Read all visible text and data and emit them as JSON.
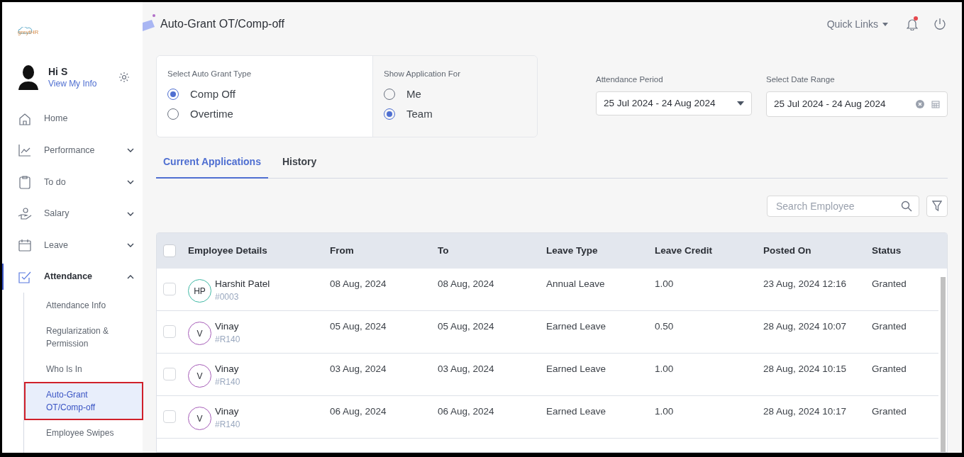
{
  "sidebar": {
    "logo_text": "greytHR",
    "greeting": "Hi S",
    "profile_link": "View My Info",
    "items": [
      {
        "label": "Home",
        "kind": "link",
        "active": false
      },
      {
        "label": "Performance",
        "kind": "group",
        "expanded": false,
        "active": false
      },
      {
        "label": "To do",
        "kind": "group",
        "expanded": false,
        "active": false
      },
      {
        "label": "Salary",
        "kind": "group",
        "expanded": false,
        "active": false
      },
      {
        "label": "Leave",
        "kind": "group",
        "expanded": false,
        "active": false
      },
      {
        "label": "Attendance",
        "kind": "group",
        "expanded": true,
        "active": true,
        "children": [
          {
            "label": "Attendance Info",
            "selected": false
          },
          {
            "label": "Regularization & Permission",
            "selected": false
          },
          {
            "label": "Who Is In",
            "selected": false
          },
          {
            "label": "Auto-Grant OT/Comp-off",
            "selected": true
          },
          {
            "label": "Employee Swipes",
            "selected": false
          }
        ]
      }
    ]
  },
  "header": {
    "title": "Auto-Grant OT/Comp-off",
    "quick_links": "Quick Links",
    "has_notification": true
  },
  "grant_type": {
    "label": "Select Auto Grant Type",
    "options": [
      {
        "label": "Comp Off",
        "selected": true
      },
      {
        "label": "Overtime",
        "selected": false
      }
    ]
  },
  "application_for": {
    "label": "Show Application For",
    "options": [
      {
        "label": "Me",
        "selected": false
      },
      {
        "label": "Team",
        "selected": true
      }
    ]
  },
  "attendance_period": {
    "label": "Attendance Period",
    "value": "25 Jul 2024 - 24 Aug 2024"
  },
  "date_range": {
    "label": "Select Date Range",
    "value": "25 Jul 2024 - 24 Aug 2024"
  },
  "tabs": [
    {
      "label": "Current Applications",
      "selected": true
    },
    {
      "label": "History",
      "selected": false
    }
  ],
  "search": {
    "placeholder": "Search Employee"
  },
  "table": {
    "all_selected": false,
    "columns": [
      "Employee Details",
      "From",
      "To",
      "Leave Type",
      "Leave Credit",
      "Posted On",
      "Status"
    ],
    "rows": [
      {
        "initials": "HP",
        "color": "#3fb8a4",
        "name": "Harshit Patel",
        "id": "#0003",
        "from": "08 Aug, 2024",
        "to": "08 Aug, 2024",
        "leave_type": "Annual Leave",
        "credit": "1.00",
        "posted_on": "23 Aug, 2024 12:16",
        "status": "Granted",
        "checked": false
      },
      {
        "initials": "V",
        "color": "#a65cb8",
        "name": "Vinay",
        "id": "#R140",
        "from": "05 Aug, 2024",
        "to": "05 Aug, 2024",
        "leave_type": "Earned Leave",
        "credit": "0.50",
        "posted_on": "28 Aug, 2024 10:07",
        "status": "Granted",
        "checked": false
      },
      {
        "initials": "V",
        "color": "#a65cb8",
        "name": "Vinay",
        "id": "#R140",
        "from": "03 Aug, 2024",
        "to": "03 Aug, 2024",
        "leave_type": "Earned Leave",
        "credit": "1.00",
        "posted_on": "28 Aug, 2024 10:15",
        "status": "Granted",
        "checked": false
      },
      {
        "initials": "V",
        "color": "#a65cb8",
        "name": "Vinay",
        "id": "#R140",
        "from": "06 Aug, 2024",
        "to": "06 Aug, 2024",
        "leave_type": "Earned Leave",
        "credit": "1.00",
        "posted_on": "28 Aug, 2024 10:17",
        "status": "Granted",
        "checked": false
      }
    ]
  }
}
